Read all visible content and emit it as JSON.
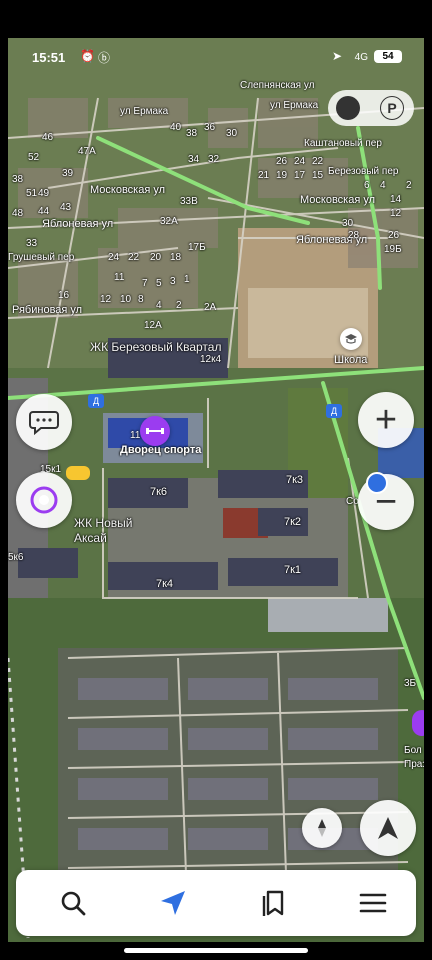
{
  "status_bar": {
    "time": "15:51",
    "network": "4G",
    "battery": "54"
  },
  "map": {
    "streets": [
      "Слепнянская ул",
      "ул Ермака",
      "ул Ермака",
      "Каштановый пер",
      "Березовый пер",
      "Московская ул",
      "Московская ул",
      "Яблоневая ул",
      "Яблоневая ул",
      "Грушевый пер",
      "Рябиновая ул"
    ],
    "places": [
      "ЖК Березовый Квартал",
      "Дворец спорта",
      "ЖК Новый Аксай",
      "Школа",
      "Бол Праз",
      "Со"
    ],
    "buildings": [
      "7к6",
      "7к3",
      "7к2",
      "7к1",
      "7к4",
      "5к6",
      "15к1",
      "12к4",
      "12А",
      "11",
      "3Б",
      "19Б",
      "33В",
      "32А",
      "17Б",
      "2А"
    ],
    "house_numbers": [
      "46",
      "52",
      "47А",
      "38",
      "39",
      "51",
      "49",
      "48",
      "44",
      "43",
      "33",
      "16",
      "24",
      "22",
      "20",
      "18",
      "11",
      "12",
      "10",
      "8",
      "7",
      "5",
      "3",
      "1",
      "4",
      "2",
      "40",
      "38",
      "36",
      "34",
      "32",
      "30",
      "21",
      "19",
      "17",
      "15",
      "26",
      "24",
      "22",
      "30",
      "28",
      "26",
      "14",
      "12",
      "6",
      "4",
      "2"
    ],
    "badges": [
      "Д",
      "Д"
    ]
  },
  "controls": {
    "zoom_in": "+",
    "zoom_out": "−",
    "parking": "P"
  },
  "bottom_bar": {
    "items": [
      "search-icon",
      "navigator-arrow-icon",
      "bookmarks-icon",
      "menu-icon"
    ]
  },
  "colors": {
    "road_major": "#8ee07a",
    "road_minor": "#d6d2c6",
    "accent_blue": "#2f6fe0",
    "alice_purple": "#9b3cf0"
  }
}
